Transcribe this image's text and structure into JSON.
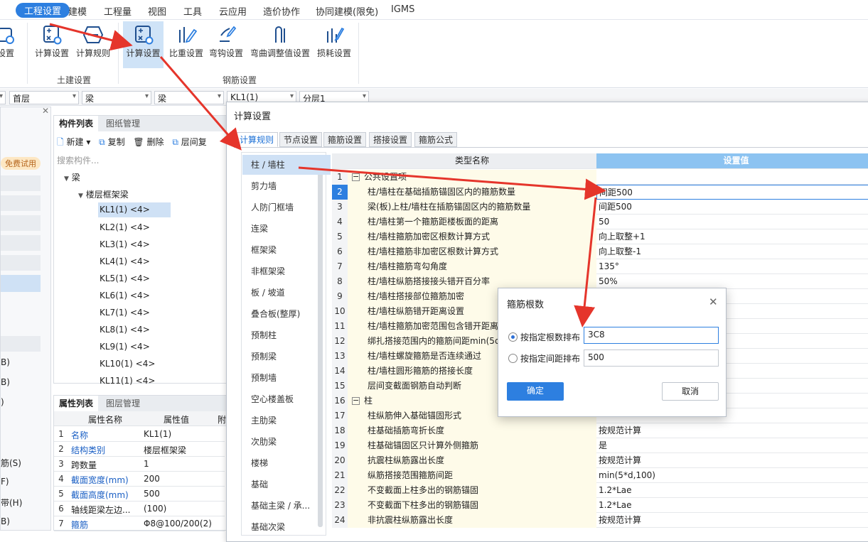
{
  "menubar": {
    "items": [
      "工程设置",
      "建模",
      "工程量",
      "视图",
      "工具",
      "云应用",
      "造价协作",
      "协同建模(限免)",
      "IGMS"
    ]
  },
  "ribbon": {
    "buttons": [
      "设置",
      "计算设置",
      "计算规则",
      "计算设置",
      "比重设置",
      "弯钩设置",
      "弯曲调整值设置",
      "损耗设置"
    ],
    "groups": {
      "civil": "土建设置",
      "rebar": "钢筋设置"
    }
  },
  "combos": [
    "首层",
    "梁",
    "梁",
    "KL1(1)",
    "分层1"
  ],
  "left_strip": {
    "badge": "免费试用",
    "items": [
      "B)",
      "B)",
      ")",
      "筋(S)",
      "F)",
      "带(H)",
      "B)"
    ]
  },
  "component_panel": {
    "tabs": [
      "构件列表",
      "图纸管理"
    ],
    "toolbar": {
      "new": "新建",
      "copy": "复制",
      "delete": "删除",
      "floor_copy": "层间复"
    },
    "search_placeholder": "搜索构件...",
    "tree_root": "梁",
    "tree_group": "楼层框架梁",
    "items": [
      "KL1(1) <4>",
      "KL2(1) <4>",
      "KL3(1) <4>",
      "KL4(1) <4>",
      "KL5(1) <4>",
      "KL6(1) <4>",
      "KL7(1) <4>",
      "KL8(1) <4>",
      "KL9(1) <4>",
      "KL10(1) <4>",
      "KL11(1) <4>"
    ]
  },
  "property_panel": {
    "tabs": [
      "属性列表",
      "图层管理"
    ],
    "headers": [
      "属性名称",
      "属性值",
      "附"
    ],
    "rows": [
      {
        "n": "1",
        "k": "名称",
        "v": "KL1(1)"
      },
      {
        "n": "2",
        "k": "结构类别",
        "v": "楼层框架梁"
      },
      {
        "n": "3",
        "k": "跨数量",
        "v": "1"
      },
      {
        "n": "4",
        "k": "截面宽度(mm)",
        "v": "200"
      },
      {
        "n": "5",
        "k": "截面高度(mm)",
        "v": "500"
      },
      {
        "n": "6",
        "k": "轴线距梁左边...",
        "v": "(100)"
      },
      {
        "n": "7",
        "k": "箍筋",
        "v": "Φ8@100/200(2)"
      }
    ]
  },
  "calc_dialog": {
    "title": "计算设置",
    "tabs": [
      "计算规则",
      "节点设置",
      "箍筋设置",
      "搭接设置",
      "箍筋公式"
    ],
    "categories": [
      "柱 / 墙柱",
      "剪力墙",
      "人防门框墙",
      "连梁",
      "框架梁",
      "非框架梁",
      "板 / 坡道",
      "叠合板(整厚)",
      "预制柱",
      "预制梁",
      "预制墙",
      "空心楼盖板",
      "主肋梁",
      "次肋梁",
      "楼梯",
      "基础",
      "基础主梁 / 承...",
      "基础次梁"
    ],
    "grid_headers": {
      "name": "类型名称",
      "value": "设置值"
    },
    "rows": [
      {
        "no": "1",
        "name": "公共设置项",
        "value": "",
        "header": true
      },
      {
        "no": "2",
        "name": "柱/墙柱在基础插筋锚固区内的箍筋数量",
        "value": "间距500"
      },
      {
        "no": "3",
        "name": "梁(板)上柱/墙柱在插筋锚固区内的箍筋数量",
        "value": "间距500"
      },
      {
        "no": "4",
        "name": "柱/墙柱第一个箍筋距楼板面的距离",
        "value": "50"
      },
      {
        "no": "5",
        "name": "柱/墙柱箍筋加密区根数计算方式",
        "value": "向上取整+1"
      },
      {
        "no": "6",
        "name": "柱/墙柱箍筋非加密区根数计算方式",
        "value": "向上取整-1"
      },
      {
        "no": "7",
        "name": "柱/墙柱箍筋弯勾角度",
        "value": "135°"
      },
      {
        "no": "8",
        "name": "柱/墙柱纵筋搭接接头错开百分率",
        "value": "50%"
      },
      {
        "no": "9",
        "name": "柱/墙柱搭接部位箍筋加密",
        "value": ""
      },
      {
        "no": "10",
        "name": "柱/墙柱纵筋错开距离设置",
        "value": ""
      },
      {
        "no": "11",
        "name": "柱/墙柱箍筋加密范围包含错开距离",
        "value": ""
      },
      {
        "no": "12",
        "name": "绑扎搭接范围内的箍筋间距min(5d",
        "value": ""
      },
      {
        "no": "13",
        "name": "柱/墙柱螺旋箍筋是否连续通过",
        "value": ""
      },
      {
        "no": "14",
        "name": "柱/墙柱圆形箍筋的搭接长度",
        "value": ""
      },
      {
        "no": "15",
        "name": "层间变截面钢筋自动判断",
        "value": ""
      },
      {
        "no": "16",
        "name": "柱",
        "value": "",
        "header": true
      },
      {
        "no": "17",
        "name": "柱纵筋伸入基础锚固形式",
        "value": ""
      },
      {
        "no": "18",
        "name": "柱基础插筋弯折长度",
        "value": "按规范计算"
      },
      {
        "no": "19",
        "name": "柱基础锚固区只计算外侧箍筋",
        "value": "是"
      },
      {
        "no": "20",
        "name": "抗震柱纵筋露出长度",
        "value": "按规范计算"
      },
      {
        "no": "21",
        "name": "纵筋搭接范围箍筋间距",
        "value": "min(5*d,100)"
      },
      {
        "no": "22",
        "name": "不变截面上柱多出的钢筋锚固",
        "value": "1.2*Lae"
      },
      {
        "no": "23",
        "name": "不变截面下柱多出的钢筋锚固",
        "value": "1.2*Lae"
      },
      {
        "no": "24",
        "name": "非抗震柱纵筋露出长度",
        "value": "按规范计算"
      }
    ]
  },
  "stirrup_dialog": {
    "title": "箍筋根数",
    "option_count": "按指定根数排布",
    "count_value": "3C8",
    "option_spacing": "按指定间距排布",
    "spacing_value": "500",
    "ok": "确定",
    "cancel": "取消"
  },
  "colors": {
    "accent": "#2d7fe0",
    "arrow": "#e5352b",
    "selection": "#cfe1f5"
  }
}
